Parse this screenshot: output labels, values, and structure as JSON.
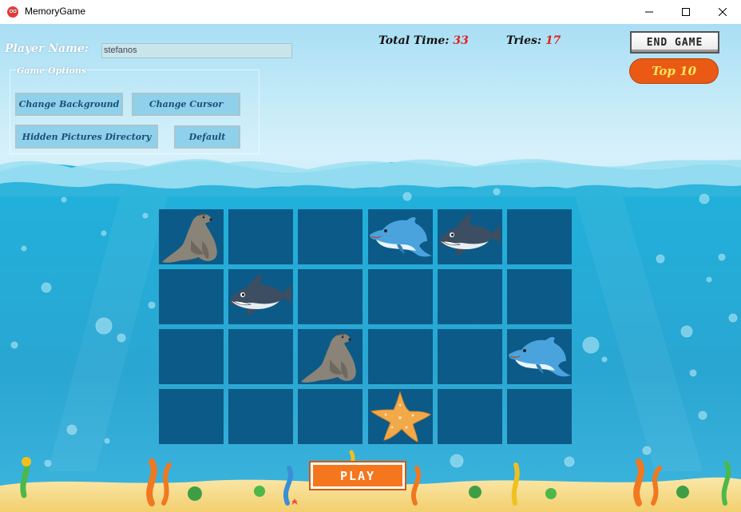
{
  "window": {
    "title": "MemoryGame"
  },
  "player": {
    "label": "Player Name:",
    "value": "stefanos"
  },
  "options": {
    "group_label": "Game Options",
    "change_background": "Change Background",
    "change_cursor": "Change Cursor",
    "hidden_pictures": "Hidden Pictures Directory",
    "default": "Default"
  },
  "stats": {
    "time_label": "Total Time:",
    "time_value": "33",
    "tries_label": "Tries:",
    "tries_value": "17"
  },
  "buttons": {
    "end_game": "END GAME",
    "top10": "Top 10",
    "play": "PLAY"
  },
  "board": {
    "rows": 4,
    "cols": 6,
    "revealed": [
      {
        "row": 0,
        "col": 0,
        "picture": "sea-lion"
      },
      {
        "row": 0,
        "col": 3,
        "picture": "dolphin"
      },
      {
        "row": 0,
        "col": 4,
        "picture": "shark"
      },
      {
        "row": 1,
        "col": 1,
        "picture": "shark"
      },
      {
        "row": 2,
        "col": 2,
        "picture": "sea-lion"
      },
      {
        "row": 2,
        "col": 5,
        "picture": "dolphin"
      },
      {
        "row": 3,
        "col": 3,
        "picture": "starfish"
      }
    ]
  },
  "colors": {
    "card_back": "#0c5a87",
    "ocean": "#1fa9d3",
    "play_button": "#f4771e",
    "top10_button": "#ea5a14",
    "stat_value": "#e02020"
  }
}
